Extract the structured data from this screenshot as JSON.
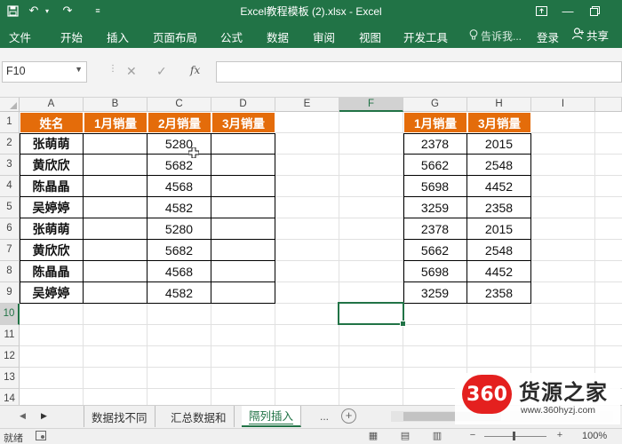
{
  "window": {
    "title": "Excel教程模板 (2).xlsx - Excel",
    "qa_menu_icon": "menu-icon",
    "qa_save_icon": "save-icon",
    "qa_undo_icon": "undo-icon",
    "qa_dropdown_icon": "dropdown-icon",
    "ribbon_options_icon": "ribbon-display-icon",
    "minimize_icon": "minimize-icon",
    "maximize_icon": "maximize-icon"
  },
  "ribbon": {
    "tabs": [
      "文件",
      "开始",
      "插入",
      "页面布局",
      "公式",
      "数据",
      "审阅",
      "视图",
      "开发工具"
    ],
    "tell_me": "告诉我...",
    "login": "登录",
    "share": "共享"
  },
  "formula_bar": {
    "name_box": "F10",
    "fx_label": "fx",
    "cancel_icon": "cancel-icon",
    "enter_icon": "check-icon",
    "formula": ""
  },
  "sheet": {
    "columns": [
      "A",
      "B",
      "C",
      "D",
      "E",
      "F",
      "G",
      "H",
      "I"
    ],
    "selected_column": "F",
    "rows": [
      "1",
      "2",
      "3",
      "4",
      "5",
      "6",
      "7",
      "8",
      "9",
      "10",
      "11",
      "12",
      "13",
      "14"
    ],
    "selected_row": "10",
    "selected_cell": "F10",
    "left_table": {
      "headers": [
        "姓名",
        "1月销量",
        "2月销量",
        "3月销量"
      ],
      "rows": [
        [
          "张萌萌",
          "",
          "5280",
          ""
        ],
        [
          "黄欣欣",
          "",
          "5682",
          ""
        ],
        [
          "陈晶晶",
          "",
          "4568",
          ""
        ],
        [
          "吴婷婷",
          "",
          "4582",
          ""
        ],
        [
          "张萌萌",
          "",
          "5280",
          ""
        ],
        [
          "黄欣欣",
          "",
          "5682",
          ""
        ],
        [
          "陈晶晶",
          "",
          "4568",
          ""
        ],
        [
          "吴婷婷",
          "",
          "4582",
          ""
        ]
      ]
    },
    "right_table": {
      "headers": [
        "1月销量",
        "3月销量"
      ],
      "rows": [
        [
          "2378",
          "2015"
        ],
        [
          "5662",
          "2548"
        ],
        [
          "5698",
          "4452"
        ],
        [
          "3259",
          "2358"
        ],
        [
          "2378",
          "2015"
        ],
        [
          "5662",
          "2548"
        ],
        [
          "5698",
          "4452"
        ],
        [
          "3259",
          "2358"
        ]
      ]
    },
    "header_fill": "#e46c0a",
    "accent": "#217346"
  },
  "sheet_tabs": {
    "tabs": [
      "数据找不同",
      "汇总数据和",
      "隔列插入"
    ],
    "active_index": 2,
    "more": "...",
    "add_icon": "plus-icon"
  },
  "status": {
    "ready": "就绪",
    "zoom": "100%"
  },
  "watermark": {
    "badge": "360",
    "title": "货源之家",
    "url": "www.360hyzj.com"
  }
}
